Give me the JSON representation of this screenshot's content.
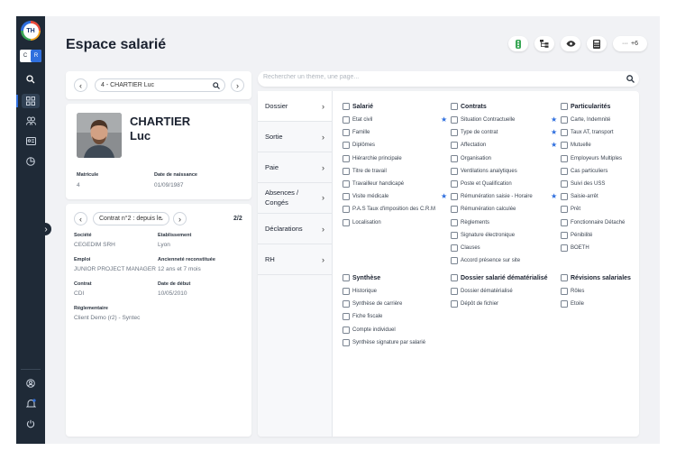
{
  "app": {
    "logo_text": "TH",
    "lang": [
      "C",
      "R"
    ]
  },
  "page_title": "Espace salarié",
  "header_actions": {
    "more_label": "+6",
    "icons": [
      "traffic-light-icon",
      "org-tree-icon",
      "eye-icon",
      "calculator-icon",
      "more-icon"
    ]
  },
  "employee_selector": {
    "value": "4 - CHARTIER Luc"
  },
  "employee": {
    "last_name": "CHARTIER",
    "first_name": "Luc",
    "matricule_label": "Matricule",
    "matricule": "4",
    "birth_label": "Date de naissance",
    "birth_date": "01/09/1987"
  },
  "contract": {
    "selector": "Contrat n°2 : depuis le",
    "pager": "2/2",
    "fields": [
      {
        "label": "Société",
        "value": "CEGEDIM SRH"
      },
      {
        "label": "Etablissement",
        "value": "Lyon"
      },
      {
        "label": "Emploi",
        "value": "JUNIOR PROJECT MANAGER"
      },
      {
        "label": "Ancienneté reconstituée",
        "value": "12 ans et 7 mois"
      },
      {
        "label": "Contrat",
        "value": "CDI"
      },
      {
        "label": "Date de début",
        "value": "10/05/2010"
      },
      {
        "label": "Réglementaire",
        "value": "Client Demo (r2) - Syntec"
      }
    ]
  },
  "search": {
    "placeholder": "Rechercher un thème, une page..."
  },
  "nav": [
    "Dossier",
    "Sortie",
    "Paie",
    "Absences / Congés",
    "Déclarations",
    "RH"
  ],
  "sections": {
    "salarie": {
      "title": "Salarié",
      "items": [
        "Etat civil",
        "Famille",
        "Diplômes",
        "Hiérarchie principale",
        "Titre de travail",
        "Travailleur handicapé",
        "Visite médicale",
        "P.A.S Taux d'imposition des C.R.M",
        "Localisation"
      ]
    },
    "contrats": {
      "title": "Contrats",
      "items": [
        "Situation Contractuelle",
        "Type de contrat",
        "Affectation",
        "Organisation",
        "Ventilations analytiques",
        "Poste et Qualification",
        "Rémunération saisie - Horaire",
        "Rémunération calculée",
        "Règlements",
        "Signature électronique",
        "Clauses",
        "Accord présence sur site"
      ]
    },
    "particularites": {
      "title": "Particularités",
      "items": [
        "Carte, Indemnité",
        "Taux AT, transport",
        "Mutuelle",
        "Employeurs Multiples",
        "Cas particuliers",
        "Suivi des USS",
        "Saisie-arrêt",
        "Prêt",
        "Fonctionnaire Détaché",
        "Pénibilité",
        "BOETH"
      ]
    },
    "synthese": {
      "title": "Synthèse",
      "items": [
        "Historique",
        "Synthèse de carrière",
        "Fiche fiscale",
        "Compte individuel",
        "Synthèse signature par salarié"
      ]
    },
    "dematerialise": {
      "title": "Dossier salarié dématérialisé",
      "items": [
        "Dossier dématérialisé",
        "Dépôt de fichier"
      ]
    },
    "revisions": {
      "title": "Révisions salariales",
      "items": [
        "Rôles",
        "Etoile"
      ]
    }
  },
  "starred": [
    "Situation Contractuelle",
    "Rémunération saisie - Horaire",
    "Carte, Indemnité",
    "Taux AT, transport",
    "Mutuelle",
    "Saisie-arrêt"
  ],
  "colors": {
    "rail": "#1f2a37",
    "accent": "#2f6fde",
    "page_bg": "#f1f2f5",
    "traffic_green": "#3aa757"
  }
}
